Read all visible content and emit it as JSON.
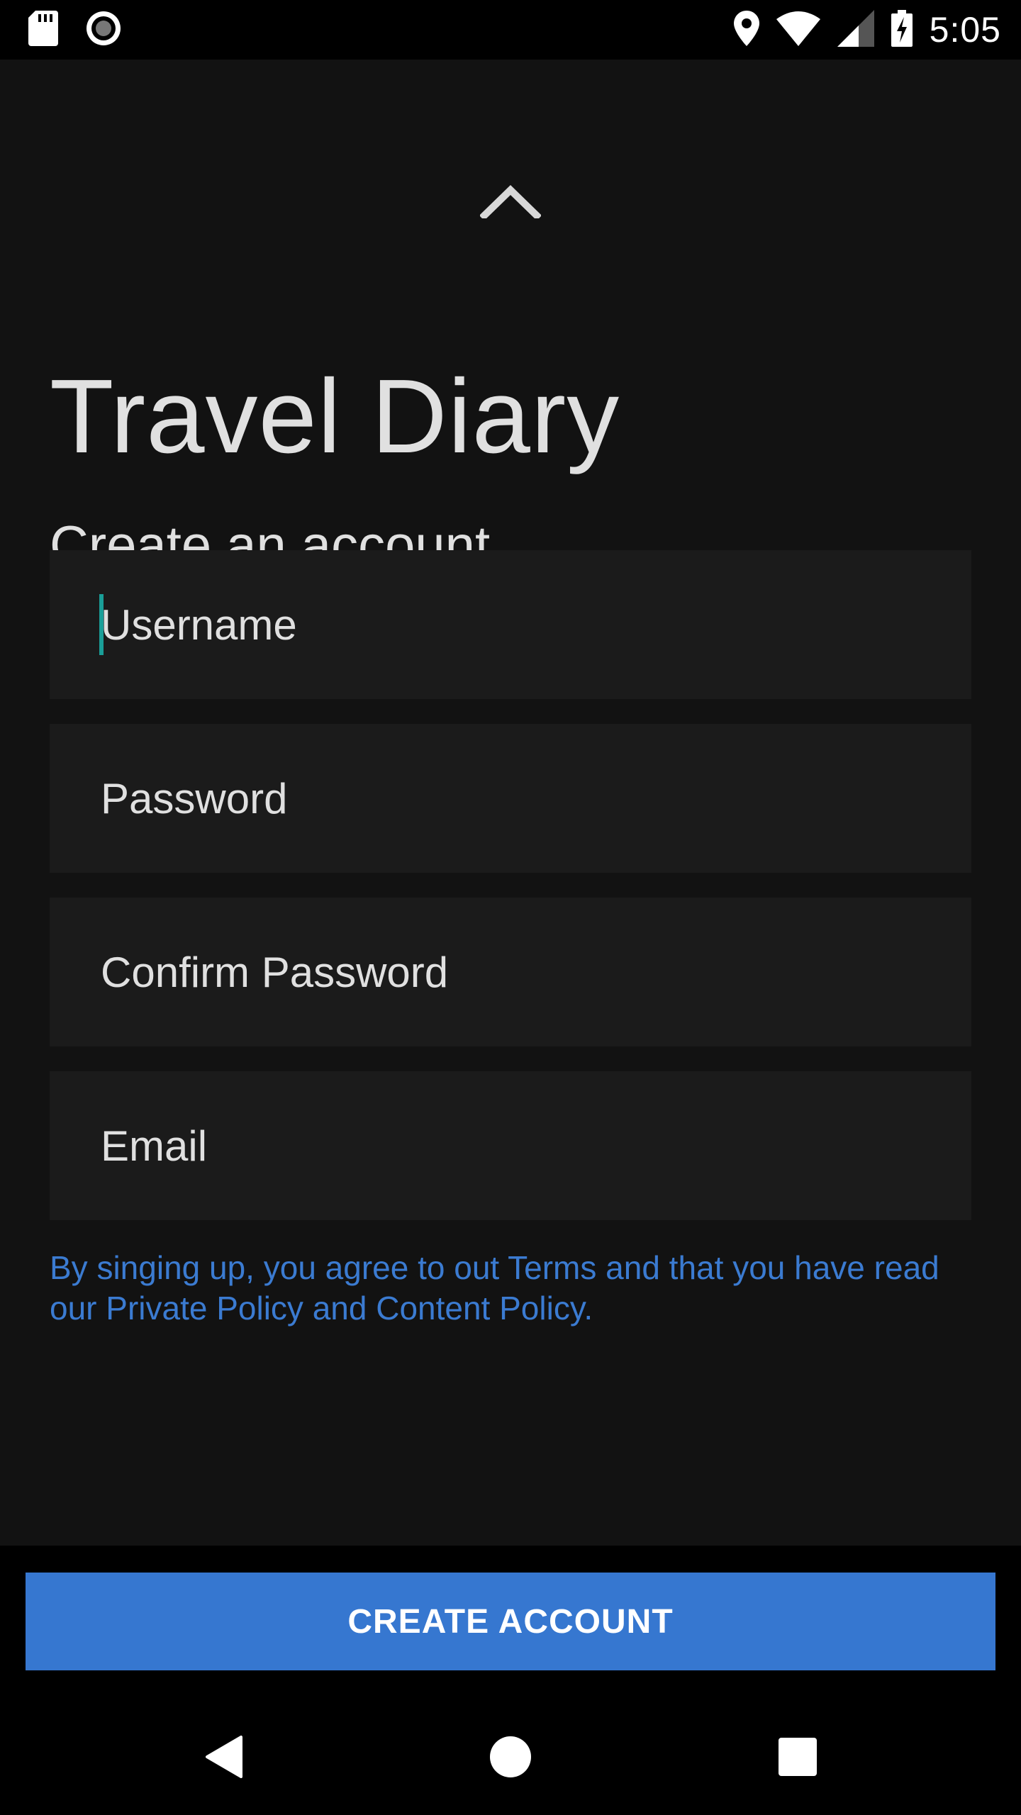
{
  "status_bar": {
    "time": "5:05",
    "icons": [
      "sd-card-icon",
      "record-icon",
      "location-icon",
      "wifi-icon",
      "signal-icon",
      "battery-charging-icon"
    ]
  },
  "collapse_icon": "chevron-up-icon",
  "app_title": "Travel Diary",
  "subtitle": "Create an account",
  "form": {
    "username": {
      "placeholder": "Username",
      "value": ""
    },
    "password": {
      "placeholder": "Password",
      "value": ""
    },
    "confirm_password": {
      "placeholder": "Confirm Password",
      "value": ""
    },
    "email": {
      "placeholder": "Email",
      "value": ""
    }
  },
  "terms_text": "By singing up, you agree to out Terms and that you have read our Private Policy and Content Policy.",
  "create_button_label": "CREATE ACCOUNT",
  "nav_bar": {
    "icons": [
      "back-icon",
      "home-icon",
      "recents-icon"
    ]
  },
  "colors": {
    "background": "#121212",
    "field_bg": "#1b1b1b",
    "accent_blue": "#3677d0",
    "link_blue": "#3b7bd1",
    "caret_teal": "#1a9e98"
  }
}
